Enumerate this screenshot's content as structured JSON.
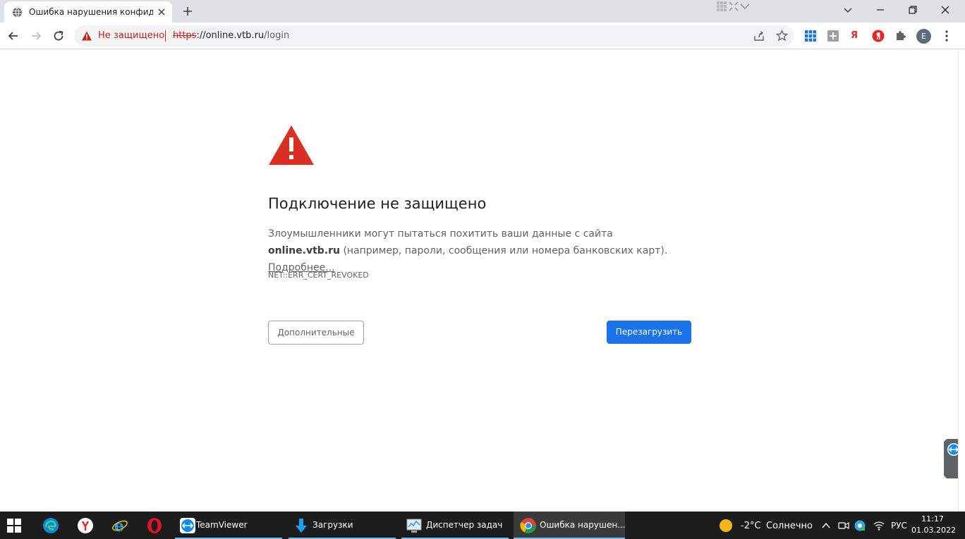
{
  "browser": {
    "tab": {
      "title": "Ошибка нарушения конфиденциальности"
    },
    "omnibox": {
      "security_state": "Не защищено",
      "url_scheme": "https",
      "url_host": "://online.vtb.ru",
      "url_path": "/login"
    },
    "profile_initial": "E",
    "extension_ya_label": "Я"
  },
  "page": {
    "heading": "Подключение не защищено",
    "explanation_start": "Злоумышленники могут пытаться похитить ваши данные с сайта ",
    "site": "online.vtb.ru",
    "explanation_end": " (например, пароли, сообщения или номера банковских карт). ",
    "learn_more": "Подробнее...",
    "error_code": "NET::ERR_CERT_REVOKED",
    "advanced_button": "Дополнительные",
    "reload_button": "Перезагрузить"
  },
  "taskbar": {
    "apps": [
      {
        "label": "TeamViewer"
      },
      {
        "label": "Загрузки"
      },
      {
        "label": "Диспетчер задач"
      },
      {
        "label": "Ошибка нарушен..."
      }
    ],
    "weather": {
      "temp": "-2°C",
      "condition": "Солнечно"
    },
    "language": "РУС",
    "time": "11:17",
    "date": "01.03.2022"
  },
  "colors": {
    "danger": "#d93025",
    "accent_blue": "#1a73e8",
    "taskbar": "#1c1c1c",
    "tabstrip": "#dee1e6"
  },
  "icons": [
    "globe-icon",
    "close-icon",
    "plus-icon",
    "back-arrow-icon",
    "forward-arrow-icon",
    "reload-icon",
    "warning-icon",
    "share-icon",
    "star-icon",
    "grid-icon",
    "puzzle-icon",
    "kebab-menu-icon",
    "windows-start-icon",
    "edge-icon",
    "yandex-browser-icon",
    "internet-explorer-icon",
    "opera-icon",
    "teamviewer-icon",
    "download-icon",
    "task-manager-icon",
    "chrome-icon",
    "sun-icon",
    "chevron-up-icon",
    "network-icon"
  ]
}
